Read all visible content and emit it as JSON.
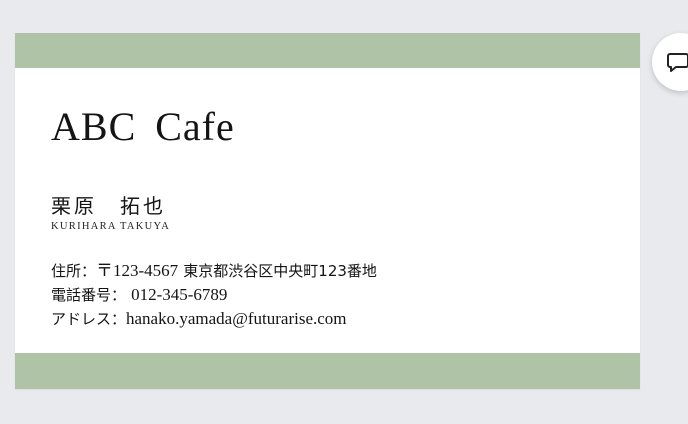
{
  "card": {
    "company": "ABC Cafe",
    "name": "栗原　拓也",
    "name_roman": "KURIHARA TAKUYA",
    "address": {
      "label": "住所：",
      "postal": "〒123-4567",
      "value": "東京都渋谷区中央町123番地"
    },
    "phone": {
      "label": "電話番号：",
      "value": "012-345-6789"
    },
    "email": {
      "label": "アドレス：",
      "value": "hanako.yamada@futurarise.com"
    }
  },
  "colors": {
    "band": "#afc3a6",
    "background": "#e9eaee",
    "card": "#ffffff"
  },
  "icons": {
    "comment": "comment-icon"
  }
}
